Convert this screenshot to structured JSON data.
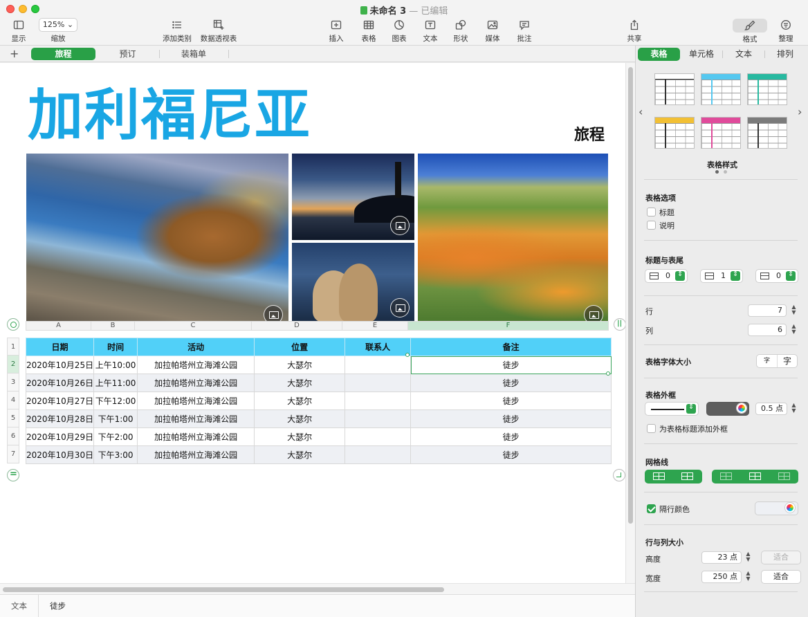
{
  "window": {
    "doc_name": "未命名 3",
    "doc_state": "— 已编辑"
  },
  "toolbar": {
    "view": "显示",
    "zoom_value": "125%",
    "zoom": "缩放",
    "add_category": "添加类别",
    "pivot_table": "数据透视表",
    "insert": "插入",
    "table": "表格",
    "chart": "图表",
    "text": "文本",
    "shape": "形状",
    "media": "媒体",
    "comment": "批注",
    "share": "共享",
    "format": "格式",
    "organize": "整理"
  },
  "sheets": [
    {
      "label": "旅程",
      "active": true
    },
    {
      "label": "预订",
      "active": false
    },
    {
      "label": "装箱单",
      "active": false
    }
  ],
  "canvas": {
    "title": "加利福尼亚",
    "subtitle": "旅程"
  },
  "table": {
    "column_letters": [
      "A",
      "B",
      "C",
      "D",
      "E",
      "F"
    ],
    "selected_column": "F",
    "headers": [
      "日期",
      "时间",
      "活动",
      "位置",
      "联系人",
      "备注"
    ],
    "header_row_number": "1",
    "rows": [
      {
        "num": "2",
        "cells": [
          "2020年10月25日",
          "上午10:00",
          "加拉帕塔州立海滩公园",
          "大瑟尔",
          "",
          "徒步"
        ]
      },
      {
        "num": "3",
        "cells": [
          "2020年10月26日",
          "上午11:00",
          "加拉帕塔州立海滩公园",
          "大瑟尔",
          "",
          "徒步"
        ]
      },
      {
        "num": "4",
        "cells": [
          "2020年10月27日",
          "下午12:00",
          "加拉帕塔州立海滩公园",
          "大瑟尔",
          "",
          "徒步"
        ]
      },
      {
        "num": "5",
        "cells": [
          "2020年10月28日",
          "下午1:00",
          "加拉帕塔州立海滩公园",
          "大瑟尔",
          "",
          "徒步"
        ]
      },
      {
        "num": "6",
        "cells": [
          "2020年10月29日",
          "下午2:00",
          "加拉帕塔州立海滩公园",
          "大瑟尔",
          "",
          "徒步"
        ]
      },
      {
        "num": "7",
        "cells": [
          "2020年10月30日",
          "下午3:00",
          "加拉帕塔州立海滩公园",
          "大瑟尔",
          "",
          "徒步"
        ]
      }
    ],
    "header_color": "#51d0f8"
  },
  "statusbar": {
    "label": "文本",
    "value": "徒步"
  },
  "inspector": {
    "tabs": [
      "表格",
      "单元格",
      "文本",
      "排列"
    ],
    "active_tab": "表格",
    "styles_label": "表格样式",
    "style_colors": [
      "#ffffff",
      "#55c8f0",
      "#27b9a0",
      "#f2c035",
      "#e04b9b",
      "#7b7b7b"
    ],
    "table_options": {
      "title": "表格选项",
      "title_checkbox": "标题",
      "caption_checkbox": "说明"
    },
    "headers_footers": {
      "title": "标题与表尾",
      "header_rows": "0",
      "header_cols": "1",
      "footer_rows": "0"
    },
    "rows_label": "行",
    "rows_value": "7",
    "cols_label": "列",
    "cols_value": "6",
    "font_size": {
      "title": "表格字体大小",
      "smaller": "字",
      "larger": "字"
    },
    "outline": {
      "title": "表格外框",
      "width": "0.5 点",
      "outline_title_checkbox": "为表格标题添加外框"
    },
    "gridlines_title": "网格线",
    "alternating": {
      "label": "隔行颜色",
      "checked": true
    },
    "row_col_size": {
      "title": "行与列大小",
      "height_label": "高度",
      "height_value": "23 点",
      "width_label": "宽度",
      "width_value": "250 点",
      "fit": "适合"
    }
  }
}
